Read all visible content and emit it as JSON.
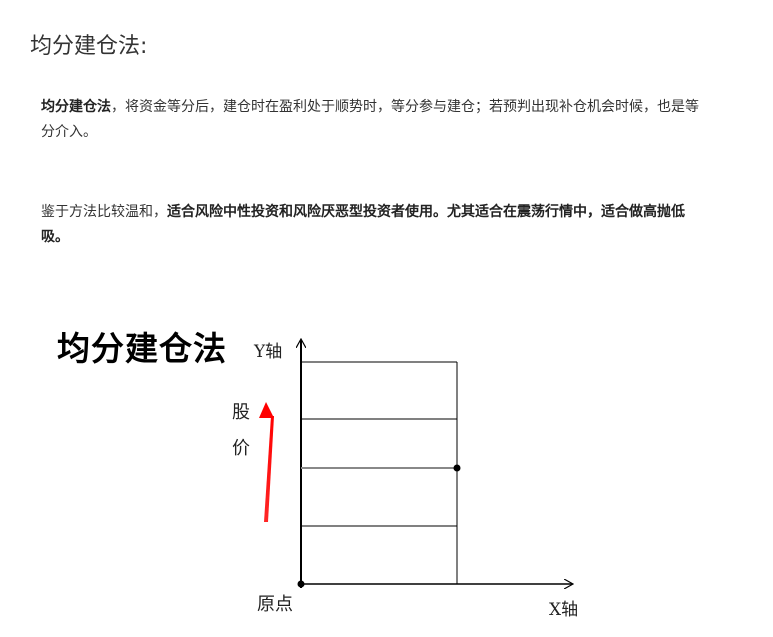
{
  "heading": "均分建仓法:",
  "paragraph1": {
    "bold": "均分建仓法",
    "rest": "，将资金等分后，建仓时在盈利处于顺势时，等分参与建仓；若预判出现补仓机会时候，也是等分介入。"
  },
  "paragraph2": {
    "lead": "鉴于方法比较温和，",
    "bold": "适合风险中性投资和风险厌恶型投资者使用。尤其适合在震荡行情中，适合做高抛低吸。"
  },
  "figure": {
    "title": "均分建仓法",
    "y_axis_label": "Y轴",
    "x_axis_label": "X轴",
    "origin_label": "原点",
    "price_label_line1": "股",
    "price_label_line2": "价",
    "arrow_color": "#ff0000"
  }
}
